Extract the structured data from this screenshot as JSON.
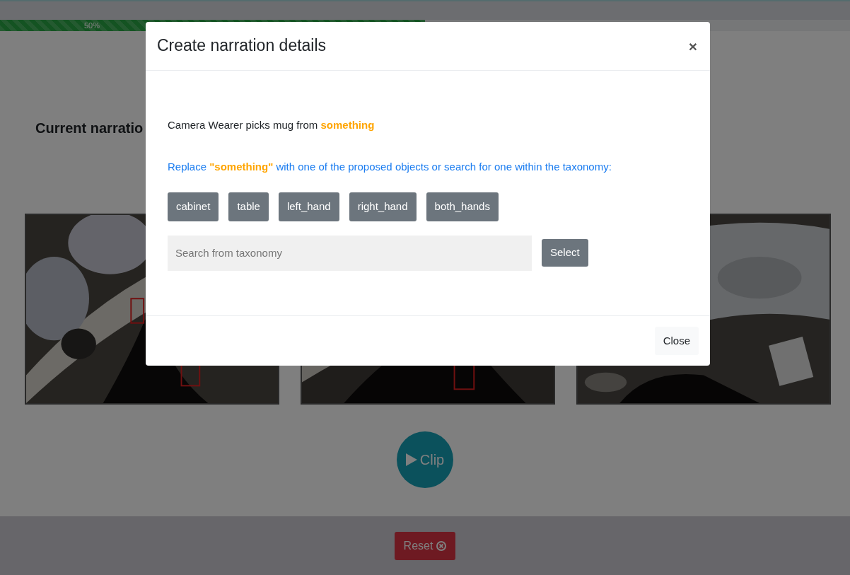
{
  "progress": {
    "level": 0.5,
    "label": "50%"
  },
  "page": {
    "heading": "Current narratio"
  },
  "clip_button": {
    "label": "Clip"
  },
  "reset_button": {
    "label": "Reset"
  },
  "modal": {
    "title": "Create narration details",
    "close_symbol": "×",
    "narration": "Camera Wearer picks mug from **something**",
    "instruction": "Replace **\"something\"** with one of the proposed objects or search for one within the taxonomy:",
    "options": [
      {
        "label": "cabinet"
      },
      {
        "label": "table"
      },
      {
        "label": "left_hand"
      },
      {
        "label": "right_hand"
      },
      {
        "label": "both_hands"
      }
    ],
    "search": {
      "placeholder": "Search from taxonomy"
    },
    "select_button": "Select",
    "close_button": "Close"
  }
}
